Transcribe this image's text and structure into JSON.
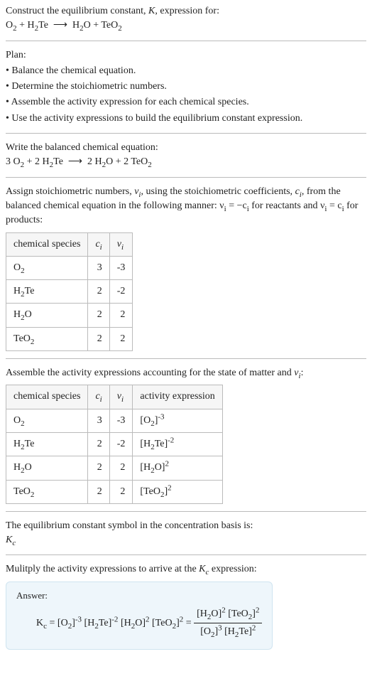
{
  "prompt": {
    "line1": "Construct the equilibrium constant, ",
    "Ksym": "K",
    "line1b": ", expression for:"
  },
  "plan": {
    "title": "Plan:",
    "items": [
      "• Balance the chemical equation.",
      "• Determine the stoichiometric numbers.",
      "• Assemble the activity expression for each chemical species.",
      "• Use the activity expressions to build the equilibrium constant expression."
    ]
  },
  "balanced_heading": "Write the balanced chemical equation:",
  "assign_text_a": "Assign stoichiometric numbers, ",
  "assign_text_b": ", using the stoichiometric coefficients, ",
  "assign_text_c": ", from the balanced chemical equation in the following manner: ",
  "assign_text_d": " for reactants and ",
  "assign_text_e": " for products:",
  "nu": "ν",
  "nu_i": "νᵢ",
  "c_i": "cᵢ",
  "table1": {
    "headers": [
      "chemical species",
      "cᵢ",
      "νᵢ"
    ],
    "rows": [
      {
        "species_html": "O<sub>2</sub>",
        "c": "3",
        "v": "-3"
      },
      {
        "species_html": "H<sub>2</sub>Te",
        "c": "2",
        "v": "-2"
      },
      {
        "species_html": "H<sub>2</sub>O",
        "c": "2",
        "v": "2"
      },
      {
        "species_html": "TeO<sub>2</sub>",
        "c": "2",
        "v": "2"
      }
    ]
  },
  "assemble_text_a": "Assemble the activity expressions accounting for the state of matter and ",
  "assemble_text_b": ":",
  "table2": {
    "headers": [
      "chemical species",
      "cᵢ",
      "νᵢ",
      "activity expression"
    ],
    "rows": [
      {
        "species_html": "O<sub>2</sub>",
        "c": "3",
        "v": "-3",
        "act_html": "[O<sub>2</sub>]<sup>-3</sup>"
      },
      {
        "species_html": "H<sub>2</sub>Te",
        "c": "2",
        "v": "-2",
        "act_html": "[H<sub>2</sub>Te]<sup>-2</sup>"
      },
      {
        "species_html": "H<sub>2</sub>O",
        "c": "2",
        "v": "2",
        "act_html": "[H<sub>2</sub>O]<sup>2</sup>"
      },
      {
        "species_html": "TeO<sub>2</sub>",
        "c": "2",
        "v": "2",
        "act_html": "[TeO<sub>2</sub>]<sup>2</sup>"
      }
    ]
  },
  "kc_line1": "The equilibrium constant symbol in the concentration basis is:",
  "kc_sym_html": "K<sub>c</sub>",
  "mult_line": "Mulitply the activity expressions to arrive at the ",
  "mult_line_b": " expression:",
  "answer_label": "Answer:",
  "unbalanced_eq_html": "O<sub>2</sub> + H<sub>2</sub>Te &nbsp;⟶&nbsp; H<sub>2</sub>O + TeO<sub>2</sub>",
  "balanced_eq_html": "3 O<sub>2</sub> + 2 H<sub>2</sub>Te &nbsp;⟶&nbsp; 2 H<sub>2</sub>O + 2 TeO<sub>2</sub>",
  "nu_eq_reactants_html": "ν<sub>i</sub> = −c<sub>i</sub>",
  "nu_eq_products_html": "ν<sub>i</sub> = c<sub>i</sub>",
  "answer_eq_left_html": "K<sub>c</sub> = [O<sub>2</sub>]<sup>-3</sup> [H<sub>2</sub>Te]<sup>-2</sup> [H<sub>2</sub>O]<sup>2</sup> [TeO<sub>2</sub>]<sup>2</sup> = ",
  "answer_frac_num_html": "[H<sub>2</sub>O]<sup>2</sup> [TeO<sub>2</sub>]<sup>2</sup>",
  "answer_frac_den_html": "[O<sub>2</sub>]<sup>3</sup> [H<sub>2</sub>Te]<sup>2</sup>"
}
